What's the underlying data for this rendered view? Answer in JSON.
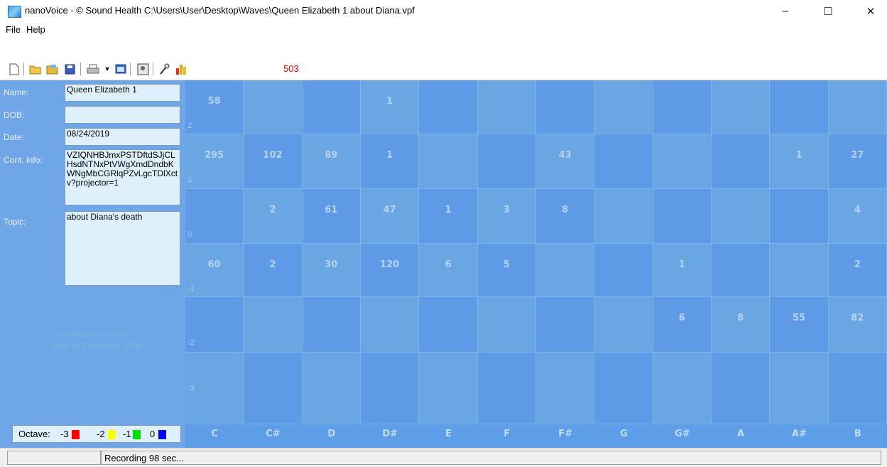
{
  "window": {
    "title": "nanoVoice - © Sound Health C:\\Users\\User\\Desktop\\Waves\\Queen Elizabeth 1 about Diana.vpf",
    "minimize": "–",
    "maximize": "☐",
    "close": "✕"
  },
  "menu": [
    "File",
    "Help"
  ],
  "toolbar": {
    "counter": "503",
    "icons": [
      "new-icon",
      "open-icon",
      "open-folder-icon",
      "save-icon",
      "print-icon",
      "dropdown-arrow-icon",
      "window-icon",
      "stamp-icon",
      "microphone-icon",
      "bar-chart-icon"
    ]
  },
  "form": {
    "name_label": "Name:",
    "name_value": "Queen Elizabeth 1",
    "dob_label": "DOB:",
    "dob_value": "",
    "date_label": "Date:",
    "date_value": "08/24/2019",
    "cont_label": "Cont. info:",
    "cont_value": "VZIQNHBJmxPSTDftdSJjCLHsdNTNxPtVWgXmdDndbKWNgMbCGRlqPZvLgcTDlXctv?projector=1",
    "topic_label": "Topic:",
    "topic_value": "about Diana's death"
  },
  "credit": {
    "line1": "Original concept",
    "line2": "© Shany Edwards 1992"
  },
  "octave": {
    "label": "Octave:",
    "items": [
      {
        "label": "-3",
        "color": "#ff0000"
      },
      {
        "label": "-2",
        "color": "#ffff00"
      },
      {
        "label": "-1",
        "color": "#00e000"
      },
      {
        "label": "0",
        "color": "#0000ff"
      }
    ]
  },
  "grid": {
    "notes": [
      "C",
      "C#",
      "D",
      "D#",
      "E",
      "F",
      "F#",
      "G",
      "G#",
      "A",
      "A#",
      "B"
    ],
    "rows": [
      {
        "octave_label": "2",
        "values": [
          "58",
          "",
          "",
          "1",
          "",
          "",
          "",
          "",
          "",
          "",
          "",
          ""
        ]
      },
      {
        "octave_label": "1",
        "values": [
          "295",
          "102",
          "89",
          "1",
          "",
          "",
          "43",
          "",
          "",
          "",
          "1",
          "27"
        ]
      },
      {
        "octave_label": "0",
        "values": [
          "",
          "2",
          "61",
          "47",
          "1",
          "3",
          "8",
          "",
          "",
          "",
          "",
          "4"
        ]
      },
      {
        "octave_label": "-1",
        "values": [
          "60",
          "2",
          "30",
          "120",
          "6",
          "5",
          "",
          "",
          "1",
          "",
          "",
          "2"
        ]
      },
      {
        "octave_label": "-2",
        "values": [
          "",
          "",
          "",
          "",
          "",
          "",
          "",
          "",
          "6",
          "8",
          "55",
          "82"
        ]
      },
      {
        "octave_label": "-3",
        "values": [
          "",
          "",
          "",
          "",
          "",
          "",
          "",
          "",
          "",
          "",
          "",
          ""
        ]
      }
    ]
  },
  "status": {
    "left": "",
    "message": "Recording 98 sec..."
  }
}
